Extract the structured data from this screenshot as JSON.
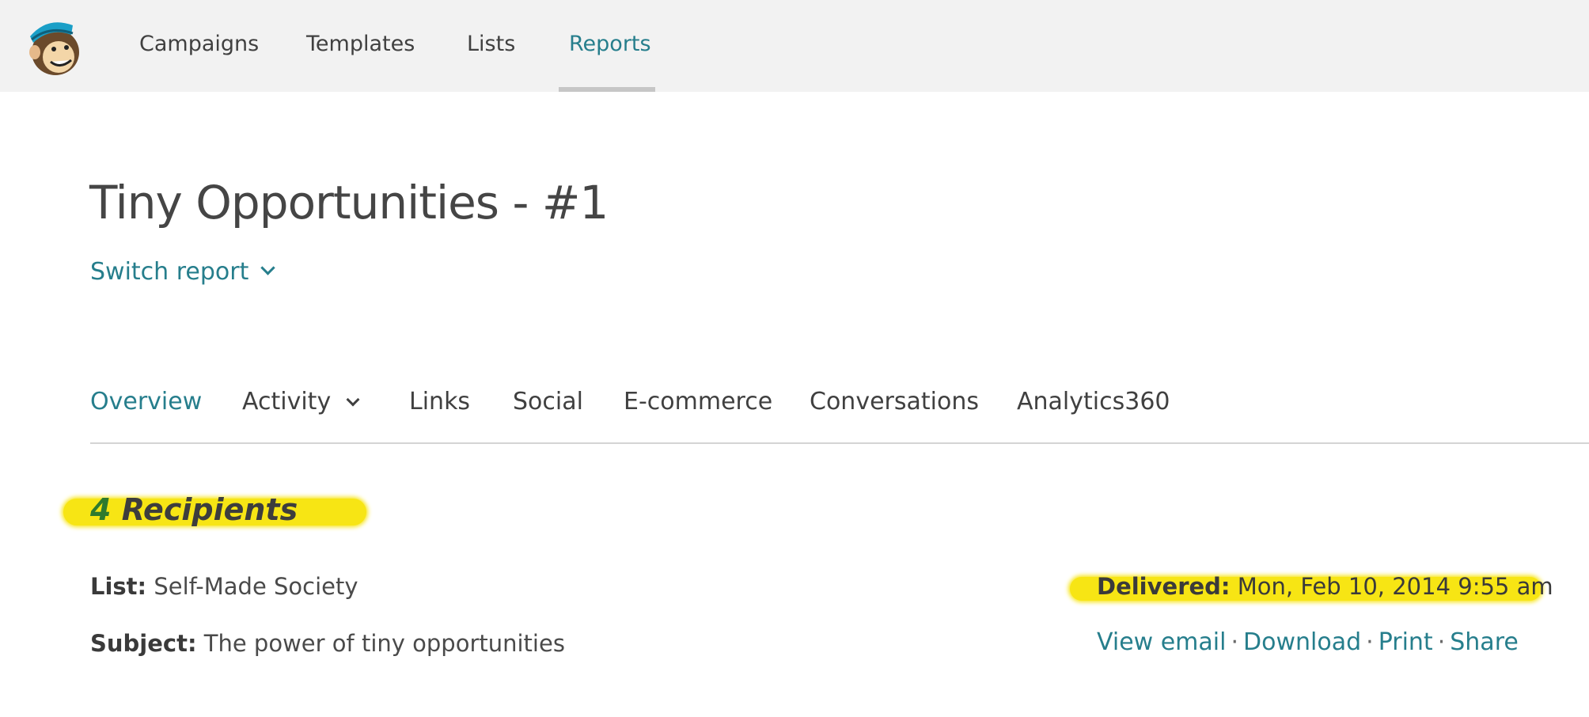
{
  "nav": {
    "items": [
      {
        "label": "Campaigns",
        "active": false
      },
      {
        "label": "Templates",
        "active": false
      },
      {
        "label": "Lists",
        "active": false
      },
      {
        "label": "Reports",
        "active": true
      }
    ]
  },
  "report": {
    "title": "Tiny Opportunities - #1",
    "switch_label": "Switch report"
  },
  "tabs": [
    {
      "label": "Overview",
      "active": true
    },
    {
      "label": "Activity",
      "active": false
    },
    {
      "label": "Links",
      "active": false
    },
    {
      "label": "Social",
      "active": false
    },
    {
      "label": "E-commerce",
      "active": false
    },
    {
      "label": "Conversations",
      "active": false
    },
    {
      "label": "Analytics360",
      "active": false
    }
  ],
  "summary": {
    "recipients_count": "4",
    "recipients_label": "Recipients",
    "list_label": "List:",
    "list_value": "Self-Made Society",
    "subject_label": "Subject:",
    "subject_value": "The power of tiny opportunities",
    "delivered_label": "Delivered:",
    "delivered_value": "Mon, Feb 10, 2014 9:55 am"
  },
  "actions": {
    "view_email": "View email",
    "download": "Download",
    "print": "Print",
    "share": "Share",
    "separator": "·"
  },
  "colors": {
    "accent": "#267e8c",
    "highlight": "#f7e514",
    "topbar": "#f2f2f2"
  }
}
